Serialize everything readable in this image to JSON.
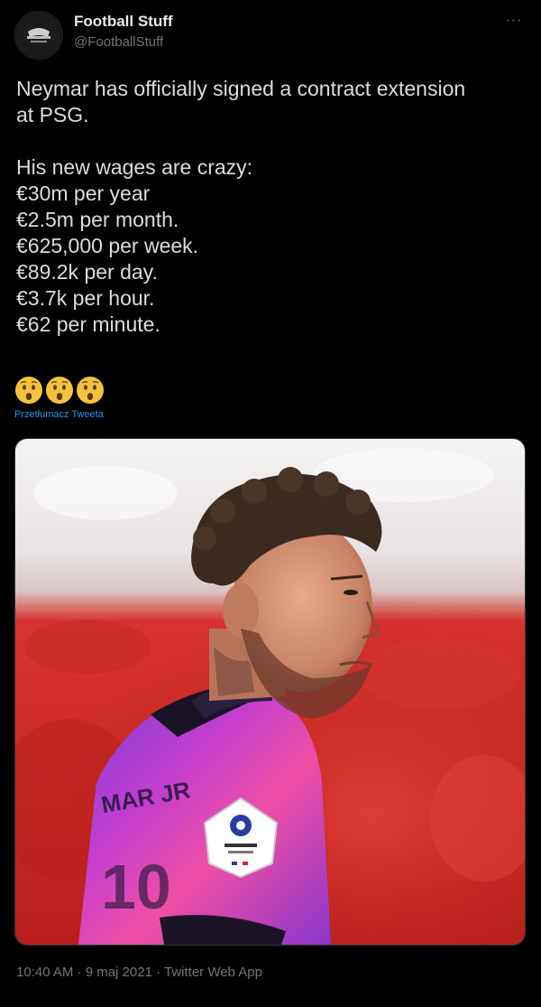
{
  "author": {
    "display_name": "Football Stuff",
    "handle": "@FootballStuff",
    "avatar_icon": "football-stuff-logo-icon"
  },
  "menu_icon": "more-options-icon",
  "menu_glyph": "···",
  "tweet": {
    "lines": [
      "Neymar has officially signed a contract extension",
      "at PSG.",
      "",
      "His new wages are crazy:",
      "€30m per year",
      "€2.5m per month.",
      "€625,000 per week.",
      "€89.2k per day.",
      "€3.7k per hour.",
      "€62 per minute."
    ],
    "emojis": [
      "hushed-face-icon",
      "hushed-face-icon",
      "hushed-face-icon"
    ],
    "translate_label": "Przetłumacz Tweeta"
  },
  "media": {
    "description_icon": "player-photo-image"
  },
  "meta": {
    "timestamp": "10:40 AM · 9 maj 2021 · Twitter Web App"
  },
  "colors": {
    "background": "#000000",
    "text": "#dcdcdc",
    "secondary": "#6e767d",
    "link": "#1d9bf0"
  }
}
